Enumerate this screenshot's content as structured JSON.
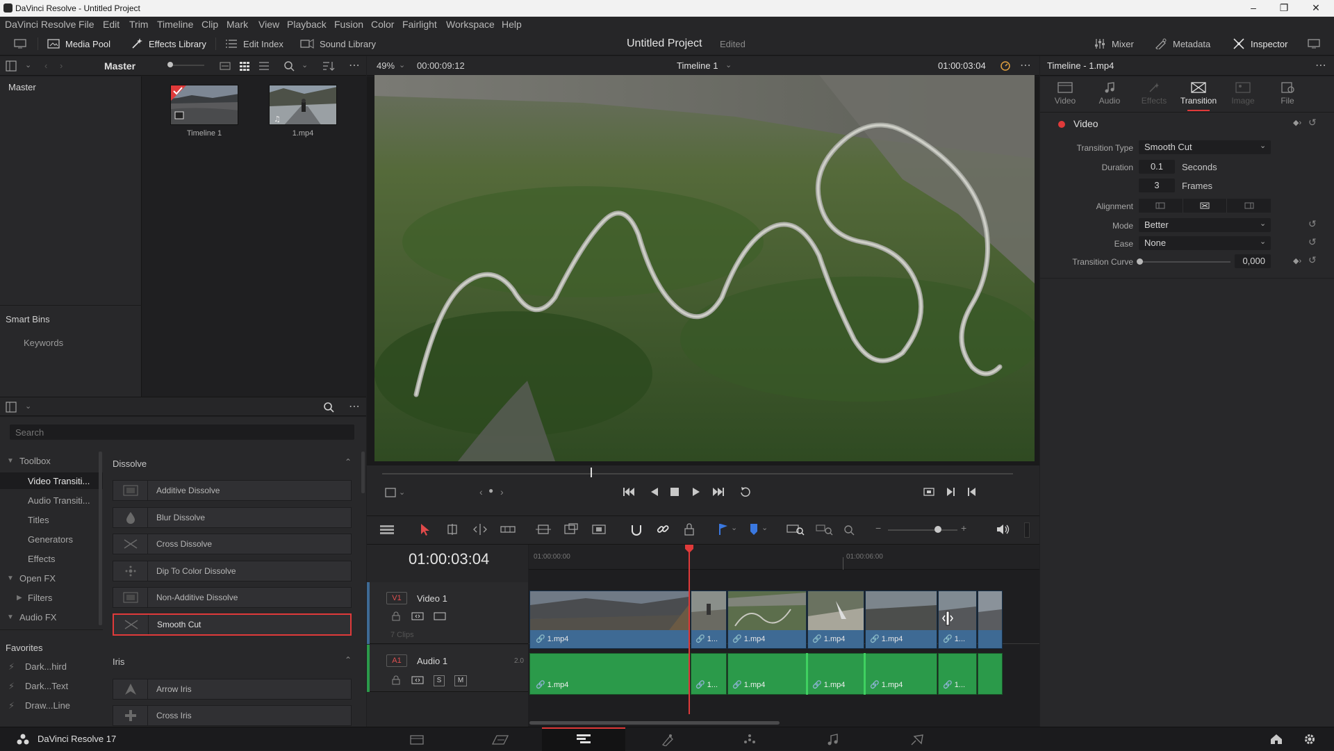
{
  "window": {
    "title": "DaVinci Resolve - Untitled Project"
  },
  "menu": [
    "DaVinci Resolve",
    "File",
    "Edit",
    "Trim",
    "Timeline",
    "Clip",
    "Mark",
    "View",
    "Playback",
    "Fusion",
    "Color",
    "Fairlight",
    "Workspace",
    "Help"
  ],
  "toolbar": {
    "media_pool": "Media Pool",
    "effects_library": "Effects Library",
    "edit_index": "Edit Index",
    "sound_library": "Sound Library",
    "project_title": "Untitled Project",
    "project_state": "Edited",
    "mixer": "Mixer",
    "metadata": "Metadata",
    "inspector": "Inspector"
  },
  "media_pool": {
    "bin_name": "Master",
    "sidebar_master": "Master",
    "smart_bins": "Smart Bins",
    "keywords": "Keywords",
    "clips": [
      {
        "label": "Timeline 1"
      },
      {
        "label": "1.mp4"
      }
    ]
  },
  "effects": {
    "search_placeholder": "Search",
    "tree": {
      "toolbox": "Toolbox",
      "video_transitions": "Video Transiti...",
      "audio_transitions": "Audio Transiti...",
      "titles": "Titles",
      "generators": "Generators",
      "effects": "Effects",
      "open_fx": "Open FX",
      "filters": "Filters",
      "audio_fx": "Audio FX",
      "favorites": "Favorites",
      "fav1": "Dark...hird",
      "fav2": "Dark...Text",
      "fav3": "Draw...Line"
    },
    "dissolve_header": "Dissolve",
    "dissolve_items": [
      "Additive Dissolve",
      "Blur Dissolve",
      "Cross Dissolve",
      "Dip To Color Dissolve",
      "Non-Additive Dissolve",
      "Smooth Cut"
    ],
    "iris_header": "Iris",
    "iris_items": [
      "Arrow Iris",
      "Cross Iris"
    ]
  },
  "viewer": {
    "zoom": "49%",
    "duration": "00:00:09:12",
    "timeline_name": "Timeline 1",
    "timecode": "01:00:03:04",
    "playhead_fraction": 0.33
  },
  "timeline": {
    "timecode": "01:00:03:04",
    "ruler": [
      "01:00:00:00",
      "01:00:06:00"
    ],
    "video_track": {
      "id": "V1",
      "name": "Video 1",
      "clips_count": "7 Clips"
    },
    "audio_track": {
      "id": "A1",
      "name": "Audio 1",
      "channels": "2.0",
      "solo": "S",
      "mute": "M"
    },
    "clip_labels": [
      "1.mp4",
      "1...",
      "1.mp4",
      "1.mp4",
      "1.mp4",
      "1..."
    ]
  },
  "inspector": {
    "title": "Timeline - 1.mp4",
    "tabs": [
      "Video",
      "Audio",
      "Effects",
      "Transition",
      "Image",
      "File"
    ],
    "section": "Video",
    "transition_type_label": "Transition Type",
    "transition_type": "Smooth Cut",
    "duration_label": "Duration",
    "duration_seconds": "0.1",
    "seconds_unit": "Seconds",
    "duration_frames": "3",
    "frames_unit": "Frames",
    "alignment_label": "Alignment",
    "mode_label": "Mode",
    "mode": "Better",
    "ease_label": "Ease",
    "ease": "None",
    "curve_label": "Transition Curve",
    "curve_value": "0,000"
  },
  "bottom": {
    "app_version": "DaVinci Resolve 17"
  },
  "colors": {
    "accent_red": "#e03a3a",
    "video_clip": "#3e6a94",
    "audio_clip": "#2b9a4a",
    "audio_clip_edge": "#3fd160"
  }
}
